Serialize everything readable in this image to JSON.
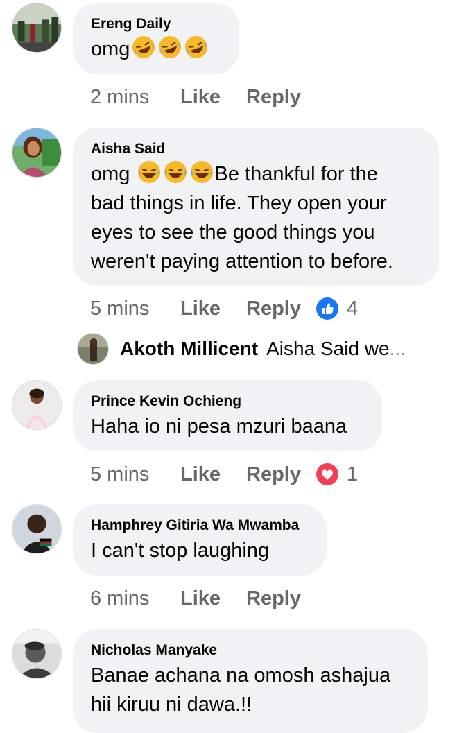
{
  "comments": [
    {
      "author": "Ereng Daily",
      "text": "omg",
      "emoji_after": [
        "rofl-emoji",
        "rofl-emoji",
        "rofl-emoji"
      ],
      "time": "2 mins",
      "like_label": "Like",
      "reply_label": "Reply"
    },
    {
      "author": "Aisha Said",
      "text_prefix": "omg ",
      "emoji_inline": [
        "joy-emoji",
        "joy-emoji",
        "joy-emoji"
      ],
      "text_line1": "Be thankful for the",
      "text_rest": "bad things in life. They open your\neyes to see the good things you\nweren't paying attention to before.",
      "time": "5 mins",
      "like_label": "Like",
      "reply_label": "Reply",
      "reaction": {
        "icon": "like-reaction-icon",
        "count": "4",
        "color": "#1877f2"
      },
      "reply_preview": {
        "name": "Akoth Millicent",
        "snippet": "Aisha Said we",
        "ellipsis": "..."
      }
    },
    {
      "author": "Prince Kevin Ochieng",
      "text": "Haha io ni pesa mzuri baana",
      "time": "5 mins",
      "like_label": "Like",
      "reply_label": "Reply",
      "reaction": {
        "icon": "love-reaction-icon",
        "count": "1",
        "color": "#f33e58"
      }
    },
    {
      "author": "Hamphrey Gitiria Wa Mwamba",
      "text": "I can't stop laughing",
      "time": "6 mins",
      "like_label": "Like",
      "reply_label": "Reply"
    },
    {
      "author": "Nicholas Manyake",
      "text": "Banae achana na omosh ashajua\nhii kiruu ni dawa.!!"
    }
  ]
}
